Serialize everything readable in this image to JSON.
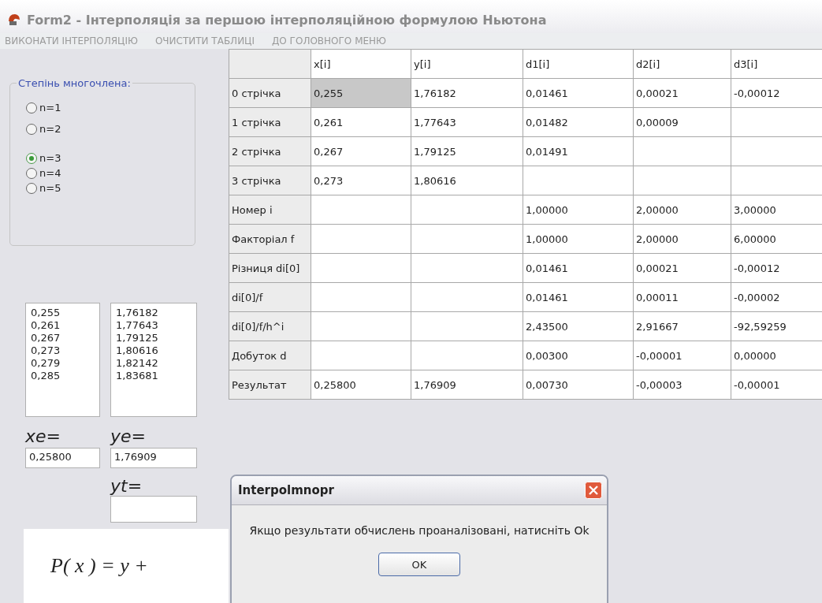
{
  "window": {
    "title": "Form2 - Інтерполяція за першою інтерполяційною формулою Ньютона"
  },
  "menu": [
    "ВИКОНАТИ ІНТЕРПОЛЯЦІЮ",
    "ОЧИСТИТИ ТАБЛИЦІ",
    "ДО ГОЛОВНОГО МЕНЮ"
  ],
  "degree_group": {
    "title": "Степінь многочлена:",
    "options": [
      {
        "label": "n=1",
        "selected": false
      },
      {
        "label": "n=2",
        "selected": false
      },
      {
        "label": "n=3",
        "selected": true
      },
      {
        "label": "n=4",
        "selected": false
      },
      {
        "label": "n=5",
        "selected": false
      }
    ]
  },
  "x_list": [
    "0,255",
    "0,261",
    "0,267",
    "0,273",
    "0,279",
    "0,285"
  ],
  "y_list": [
    "1,76182",
    "1,77643",
    "1,79125",
    "1,80616",
    "1,82142",
    "1,83681"
  ],
  "xe": {
    "label": "xe=",
    "value": "0,25800"
  },
  "ye": {
    "label": "ye=",
    "value": "1,76909"
  },
  "yt": {
    "label": "yt="
  },
  "formula": "P( x ) = y +",
  "table": {
    "columns": [
      "x[i]",
      "y[i]",
      "d1[i]",
      "d2[i]",
      "d3[i]"
    ],
    "rows": [
      {
        "header": "0 стрічка",
        "cells": [
          "0,255",
          "1,76182",
          "0,01461",
          "0,00021",
          "-0,00012"
        ],
        "cell_selected": [
          true,
          false,
          false,
          false,
          false
        ]
      },
      {
        "header": "1 стрічка",
        "cells": [
          "0,261",
          "1,77643",
          "0,01482",
          "0,00009",
          null
        ]
      },
      {
        "header": "2 стрічка",
        "cells": [
          "0,267",
          "1,79125",
          "0,01491",
          null,
          null
        ]
      },
      {
        "header": "3 стрічка",
        "cells": [
          "0,273",
          "1,80616",
          null,
          null,
          null
        ]
      },
      {
        "header": "Номер i",
        "cells": [
          null,
          null,
          "1,00000",
          "2,00000",
          "3,00000"
        ]
      },
      {
        "header": "Факторіал f",
        "cells": [
          null,
          null,
          "1,00000",
          "2,00000",
          "6,00000"
        ]
      },
      {
        "header": "Різниця di[0]",
        "cells": [
          null,
          null,
          "0,01461",
          "0,00021",
          "-0,00012"
        ]
      },
      {
        "header": "di[0]/f",
        "cells": [
          null,
          null,
          "0,01461",
          "0,00011",
          "-0,00002"
        ]
      },
      {
        "header": "di[0]/f/h^i",
        "cells": [
          null,
          null,
          "2,43500",
          "2,91667",
          "-92,59259"
        ]
      },
      {
        "header": "Добуток d",
        "cells": [
          null,
          null,
          "0,00300",
          "-0,00001",
          "0,00000"
        ]
      },
      {
        "header": "Результат",
        "cells": [
          "0,25800",
          "1,76909",
          "0,00730",
          "-0,00003",
          "-0,00001"
        ]
      }
    ]
  },
  "dialog": {
    "title": "Interpolmnopr",
    "message": "Якщо результати обчислень проаналізовані, натисніть Ok",
    "button": "OK"
  }
}
